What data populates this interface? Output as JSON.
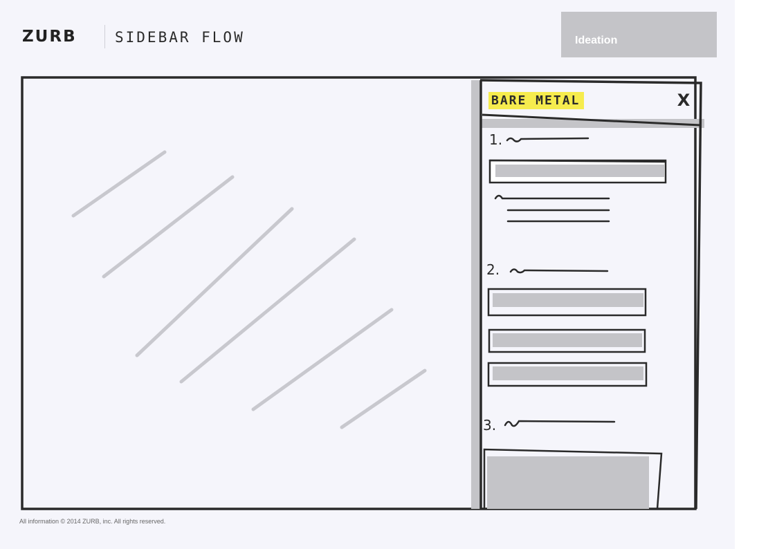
{
  "header": {
    "logo": "ZURB",
    "flow_title": "SIDEBAR FLOW",
    "stage_badge": "Ideation"
  },
  "sidebar": {
    "title": "BARE METAL",
    "close_label": "X",
    "steps": [
      {
        "number": "1."
      },
      {
        "number": "2."
      },
      {
        "number": "3."
      }
    ]
  },
  "footer": {
    "copyright": "All information © 2014 ZURB, inc.  All rights reserved."
  },
  "colors": {
    "highlight": "#f6ec4e",
    "marker": "#2a2a2a",
    "shadow": "#c4c4c8",
    "paper": "#f5f5fb"
  }
}
